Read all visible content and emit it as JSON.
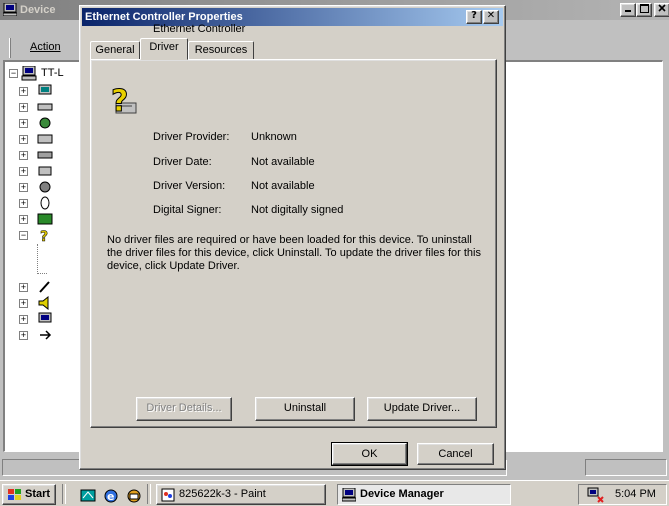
{
  "device_manager": {
    "title": "Device",
    "menu_action": "Action",
    "tree_root_label": "TT-L"
  },
  "dialog": {
    "title": "Ethernet Controller Properties",
    "help_button": "?",
    "close_button": "✕",
    "tabs": [
      {
        "label": "General"
      },
      {
        "label": "Driver"
      },
      {
        "label": "Resources"
      }
    ],
    "device_name": "Ethernet Controller",
    "fields": [
      {
        "label": "Driver Provider:",
        "value": "Unknown"
      },
      {
        "label": "Driver Date:",
        "value": "Not available"
      },
      {
        "label": "Driver Version:",
        "value": "Not available"
      },
      {
        "label": "Digital Signer:",
        "value": "Not digitally signed"
      }
    ],
    "description": "No driver files are required or have been loaded for this device. To uninstall the driver files for this device, click Uninstall. To update the driver files for this device, click Update Driver.",
    "buttons": {
      "driver_details": "Driver Details...",
      "uninstall": "Uninstall",
      "update_driver": "Update Driver...",
      "ok": "OK",
      "cancel": "Cancel"
    }
  },
  "taskbar": {
    "start_label": "Start",
    "tasks": [
      {
        "label": "825622k-3 - Paint"
      },
      {
        "label": "Device Manager"
      }
    ],
    "clock": "5:04 PM"
  }
}
